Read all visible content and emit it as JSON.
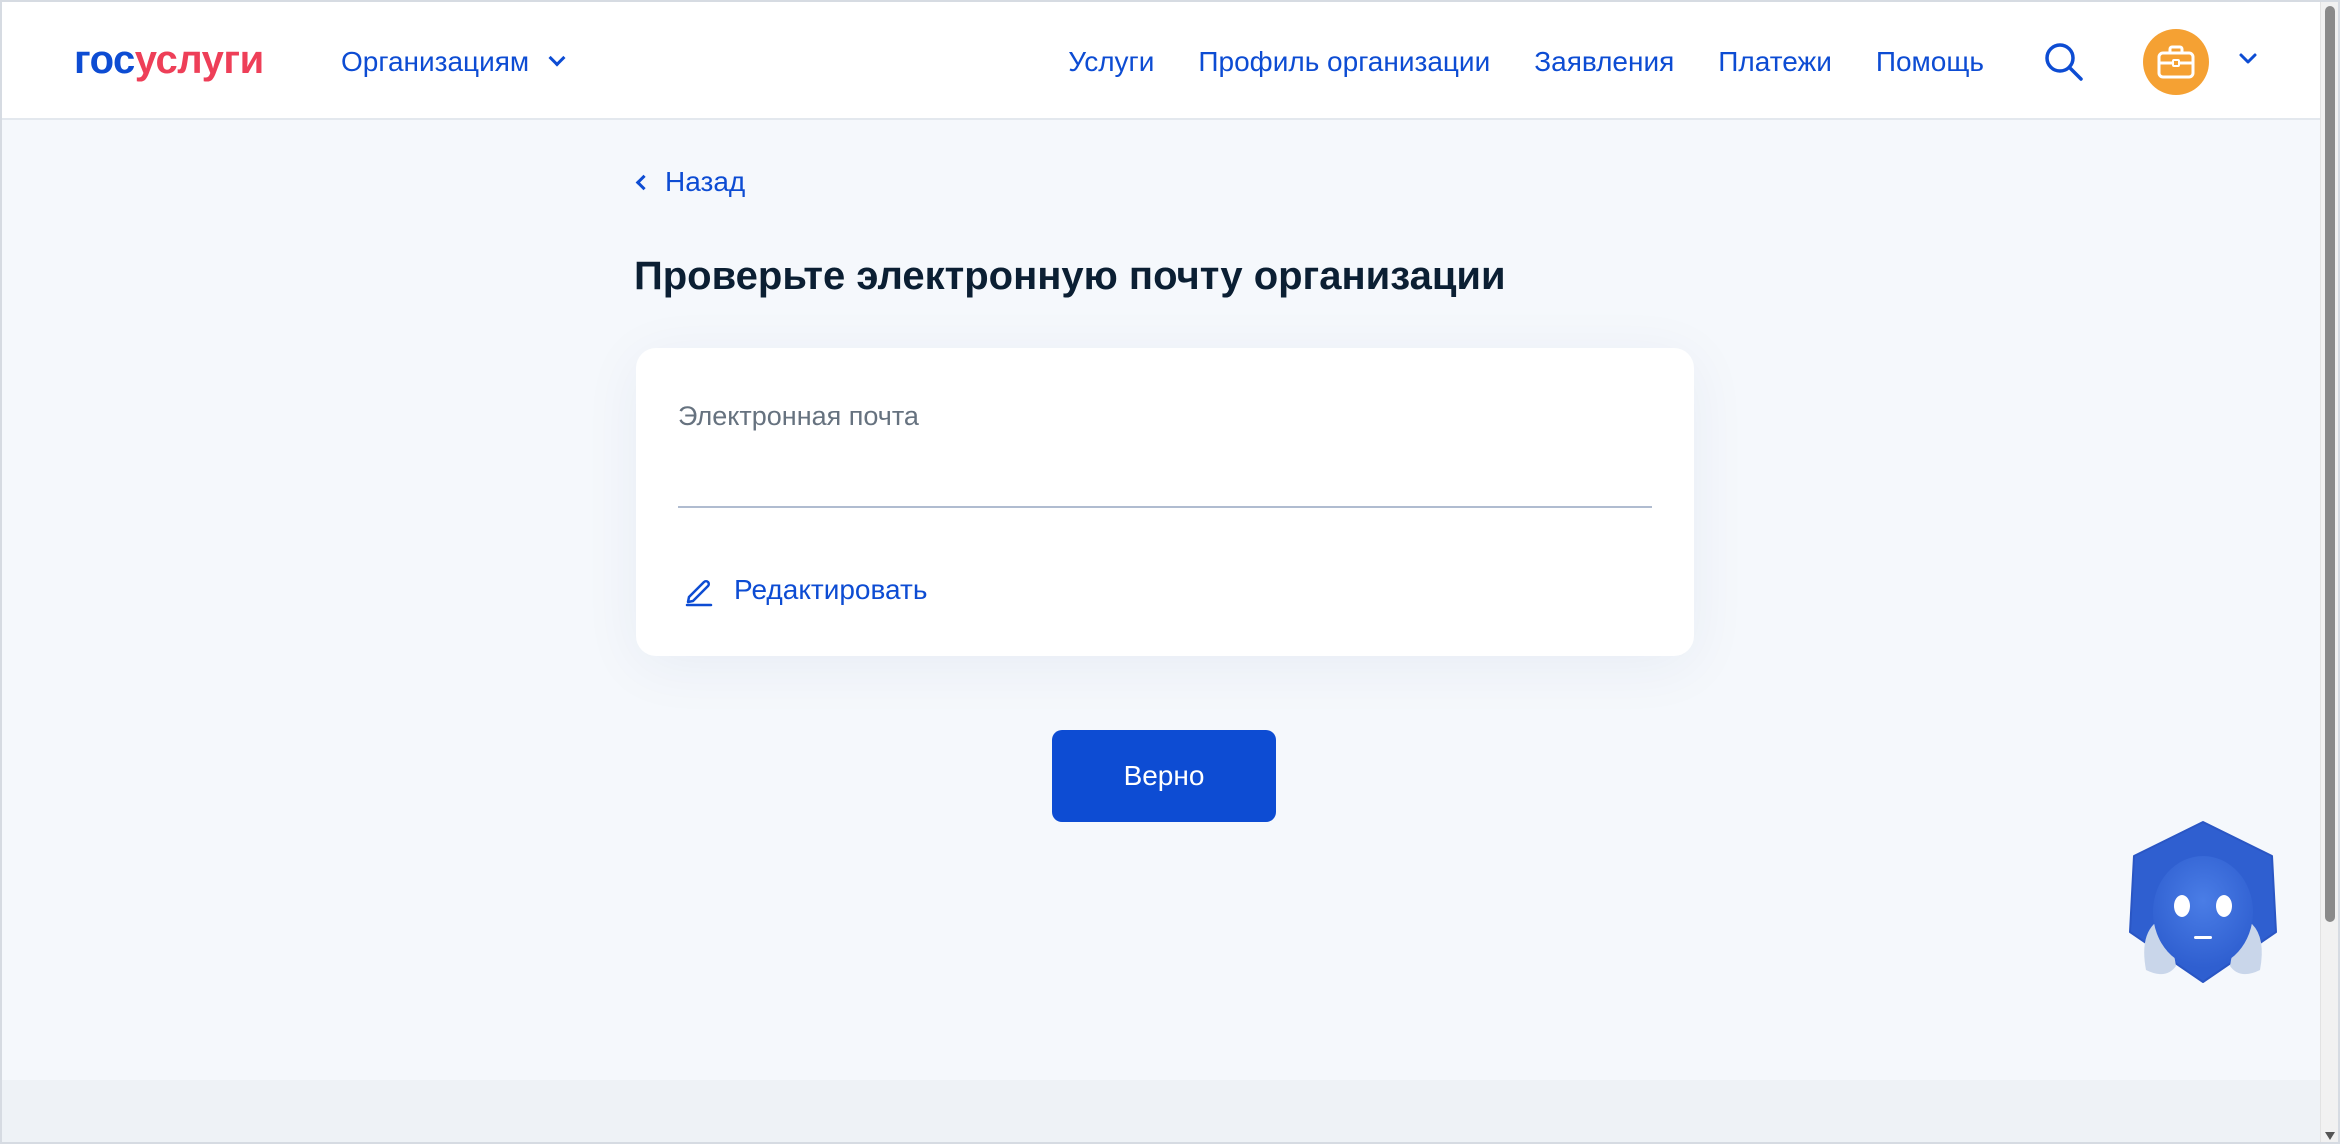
{
  "header": {
    "logo_part1": "гос",
    "logo_part2": "услуги",
    "audience_menu": "Организациям",
    "nav": [
      "Услуги",
      "Профиль организации",
      "Заявления",
      "Платежи",
      "Помощь"
    ],
    "search_icon": "search-icon",
    "avatar_icon": "briefcase-icon"
  },
  "main": {
    "back_label": "Назад",
    "title": "Проверьте электронную почту организации",
    "email_field": {
      "label": "Электронная почта",
      "value": ""
    },
    "edit_label": "Редактировать",
    "confirm_label": "Верно"
  },
  "assistant": {
    "icon": "robot-assistant-icon"
  },
  "colors": {
    "brand_blue": "#0d4cd3",
    "brand_red": "#ee3f58",
    "avatar_orange": "#f5a133",
    "background": "#f5f8fc"
  }
}
